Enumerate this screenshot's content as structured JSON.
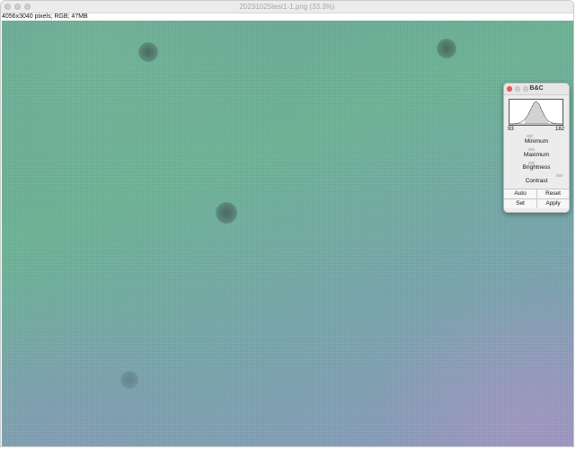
{
  "window": {
    "title": "20231025test1-1.png (33.3%)",
    "info": "4056x3040 pixels; RGB; 47MB"
  },
  "bc_dialog": {
    "title": "B&C",
    "histogram_min": "93",
    "histogram_max": "182",
    "labels": {
      "minimum": "Minimum",
      "maximum": "Maximum",
      "brightness": "Brightness",
      "contrast": "Contrast"
    },
    "buttons": {
      "auto": "Auto",
      "reset": "Reset",
      "set": "Set",
      "apply": "Apply"
    }
  },
  "colors": {
    "close_light": "#ee5f58",
    "image_tint": "#6bb596"
  }
}
